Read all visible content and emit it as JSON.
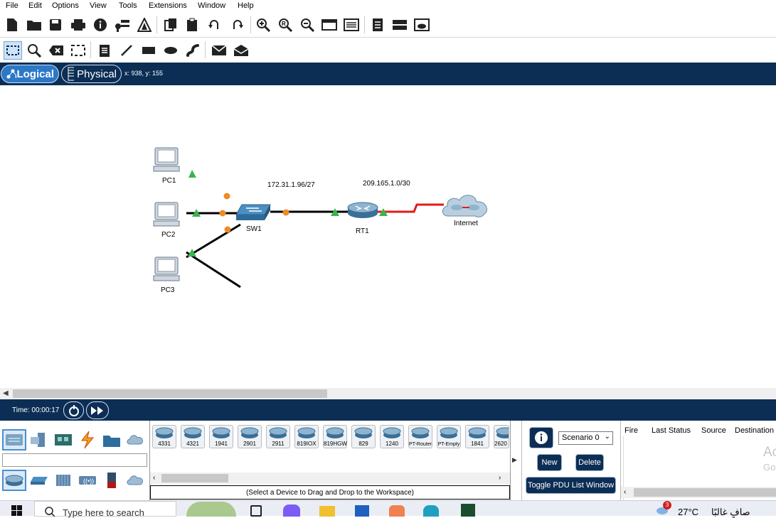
{
  "menu": [
    "File",
    "Edit",
    "Options",
    "View",
    "Tools",
    "Extensions",
    "Window",
    "Help"
  ],
  "tabs": {
    "logical": "Logical",
    "physical": "Physical"
  },
  "coords": "x: 938, y: 155",
  "topology": {
    "devices": {
      "pc1": "PC1",
      "pc2": "PC2",
      "pc3": "PC3",
      "sw1": "SW1",
      "rt1": "RT1",
      "internet": "Internet"
    },
    "networks": {
      "lan": "172.31.1.96/27",
      "wan": "209.165.1.0/30"
    }
  },
  "time": "Time: 00:00:17",
  "device_models": [
    "4331",
    "4321",
    "1941",
    "2901",
    "2911",
    "819IOX",
    "819HGW",
    "829",
    "1240",
    "PT-Router",
    "PT-Empty",
    "1841",
    "2620"
  ],
  "device_hint": "(Select a Device to Drag and Drop to the Workspace)",
  "scenario": {
    "selected": "Scenario 0",
    "new": "New",
    "delete": "Delete",
    "toggle": "Toggle PDU List Window"
  },
  "pdu_columns": [
    "Fire",
    "Last Status",
    "Source",
    "Destination"
  ],
  "taskbar": {
    "search_placeholder": "Type here to search",
    "weather": "27°C",
    "weather_text": "صافٍ غالبًا",
    "notif": "3"
  },
  "watermark": {
    "activate1": "Ac",
    "activate2": "Go"
  },
  "colors": {
    "navy": "#0c2e55",
    "link_up": "#3cb44b",
    "link_port": "#f08a24",
    "serial": "#e01b1b"
  }
}
